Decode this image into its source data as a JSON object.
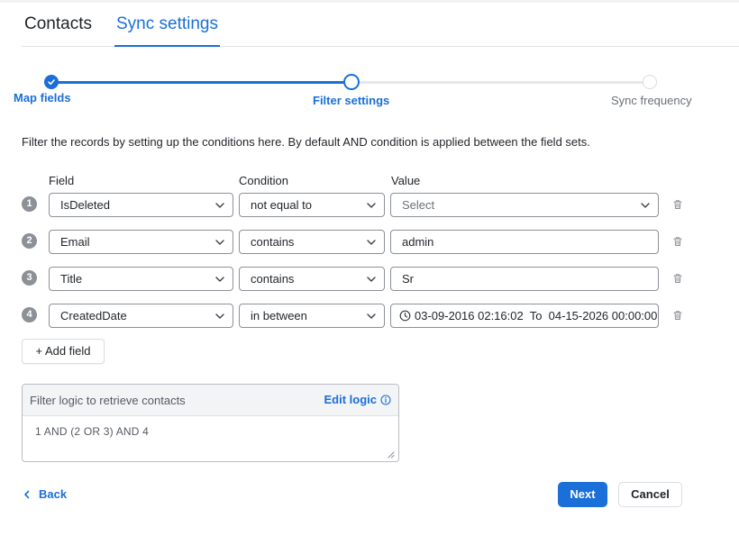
{
  "tabs": [
    {
      "label": "Contacts"
    },
    {
      "label": "Sync settings"
    }
  ],
  "stepper": {
    "steps": [
      {
        "label": "Map fields",
        "status": "done"
      },
      {
        "label": "Filter settings",
        "status": "current"
      },
      {
        "label": "Sync frequency",
        "status": "todo"
      }
    ]
  },
  "description": "Filter the records by setting up the conditions here. By default AND condition is applied between the field sets.",
  "columns": {
    "field": "Field",
    "condition": "Condition",
    "value": "Value"
  },
  "rows": [
    {
      "num": "1",
      "field": "IsDeleted",
      "condition": "not equal to",
      "value": "Select",
      "value_type": "select-placeholder"
    },
    {
      "num": "2",
      "field": "Email",
      "condition": "contains",
      "value": "admin",
      "value_type": "text"
    },
    {
      "num": "3",
      "field": "Title",
      "condition": "contains",
      "value": "Sr",
      "value_type": "text"
    },
    {
      "num": "4",
      "field": "CreatedDate",
      "condition": "in between",
      "value": "03-09-2016 02:16:02  To  04-15-2026 00:00:00",
      "value_type": "daterange"
    }
  ],
  "add_field_label": "+ Add field",
  "filter_logic": {
    "title": "Filter logic to retrieve contacts",
    "edit_label": "Edit logic",
    "value": "1 AND (2 OR 3) AND 4"
  },
  "footer": {
    "back_label": "Back",
    "next_label": "Next",
    "cancel_label": "Cancel"
  },
  "colors": {
    "accent": "#1a6fd8",
    "row_badge": "#8c9097",
    "border": "#8c9097"
  },
  "icons": [
    "check-icon",
    "chevron-down-icon",
    "trash-icon",
    "clock-icon",
    "info-icon",
    "chevron-left-icon",
    "resize-handle-icon"
  ]
}
